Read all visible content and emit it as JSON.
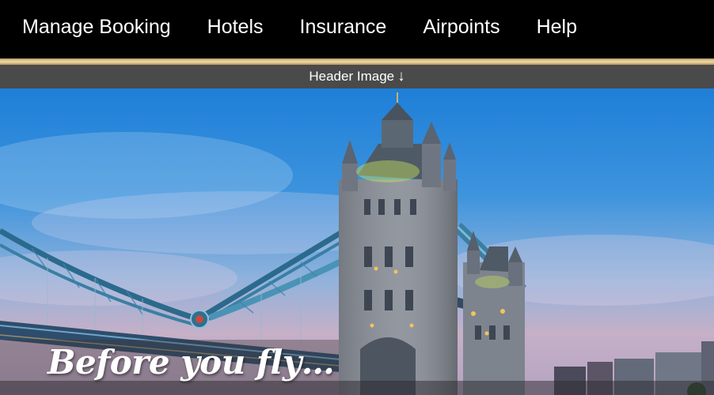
{
  "nav": {
    "items": [
      {
        "label": "Manage Booking"
      },
      {
        "label": "Hotels"
      },
      {
        "label": "Insurance"
      },
      {
        "label": "Airpoints"
      },
      {
        "label": "Help"
      }
    ]
  },
  "header_bar": {
    "label": "Header Image",
    "arrow": "↓"
  },
  "hero": {
    "title": "Before you fly…",
    "image_subject": "tower-bridge-london-image"
  },
  "colors": {
    "nav_bg": "#000000",
    "gold_accent": "#d9c08a",
    "header_bar_bg": "#4a4a4a",
    "sky_top": "#1e7fd8"
  }
}
